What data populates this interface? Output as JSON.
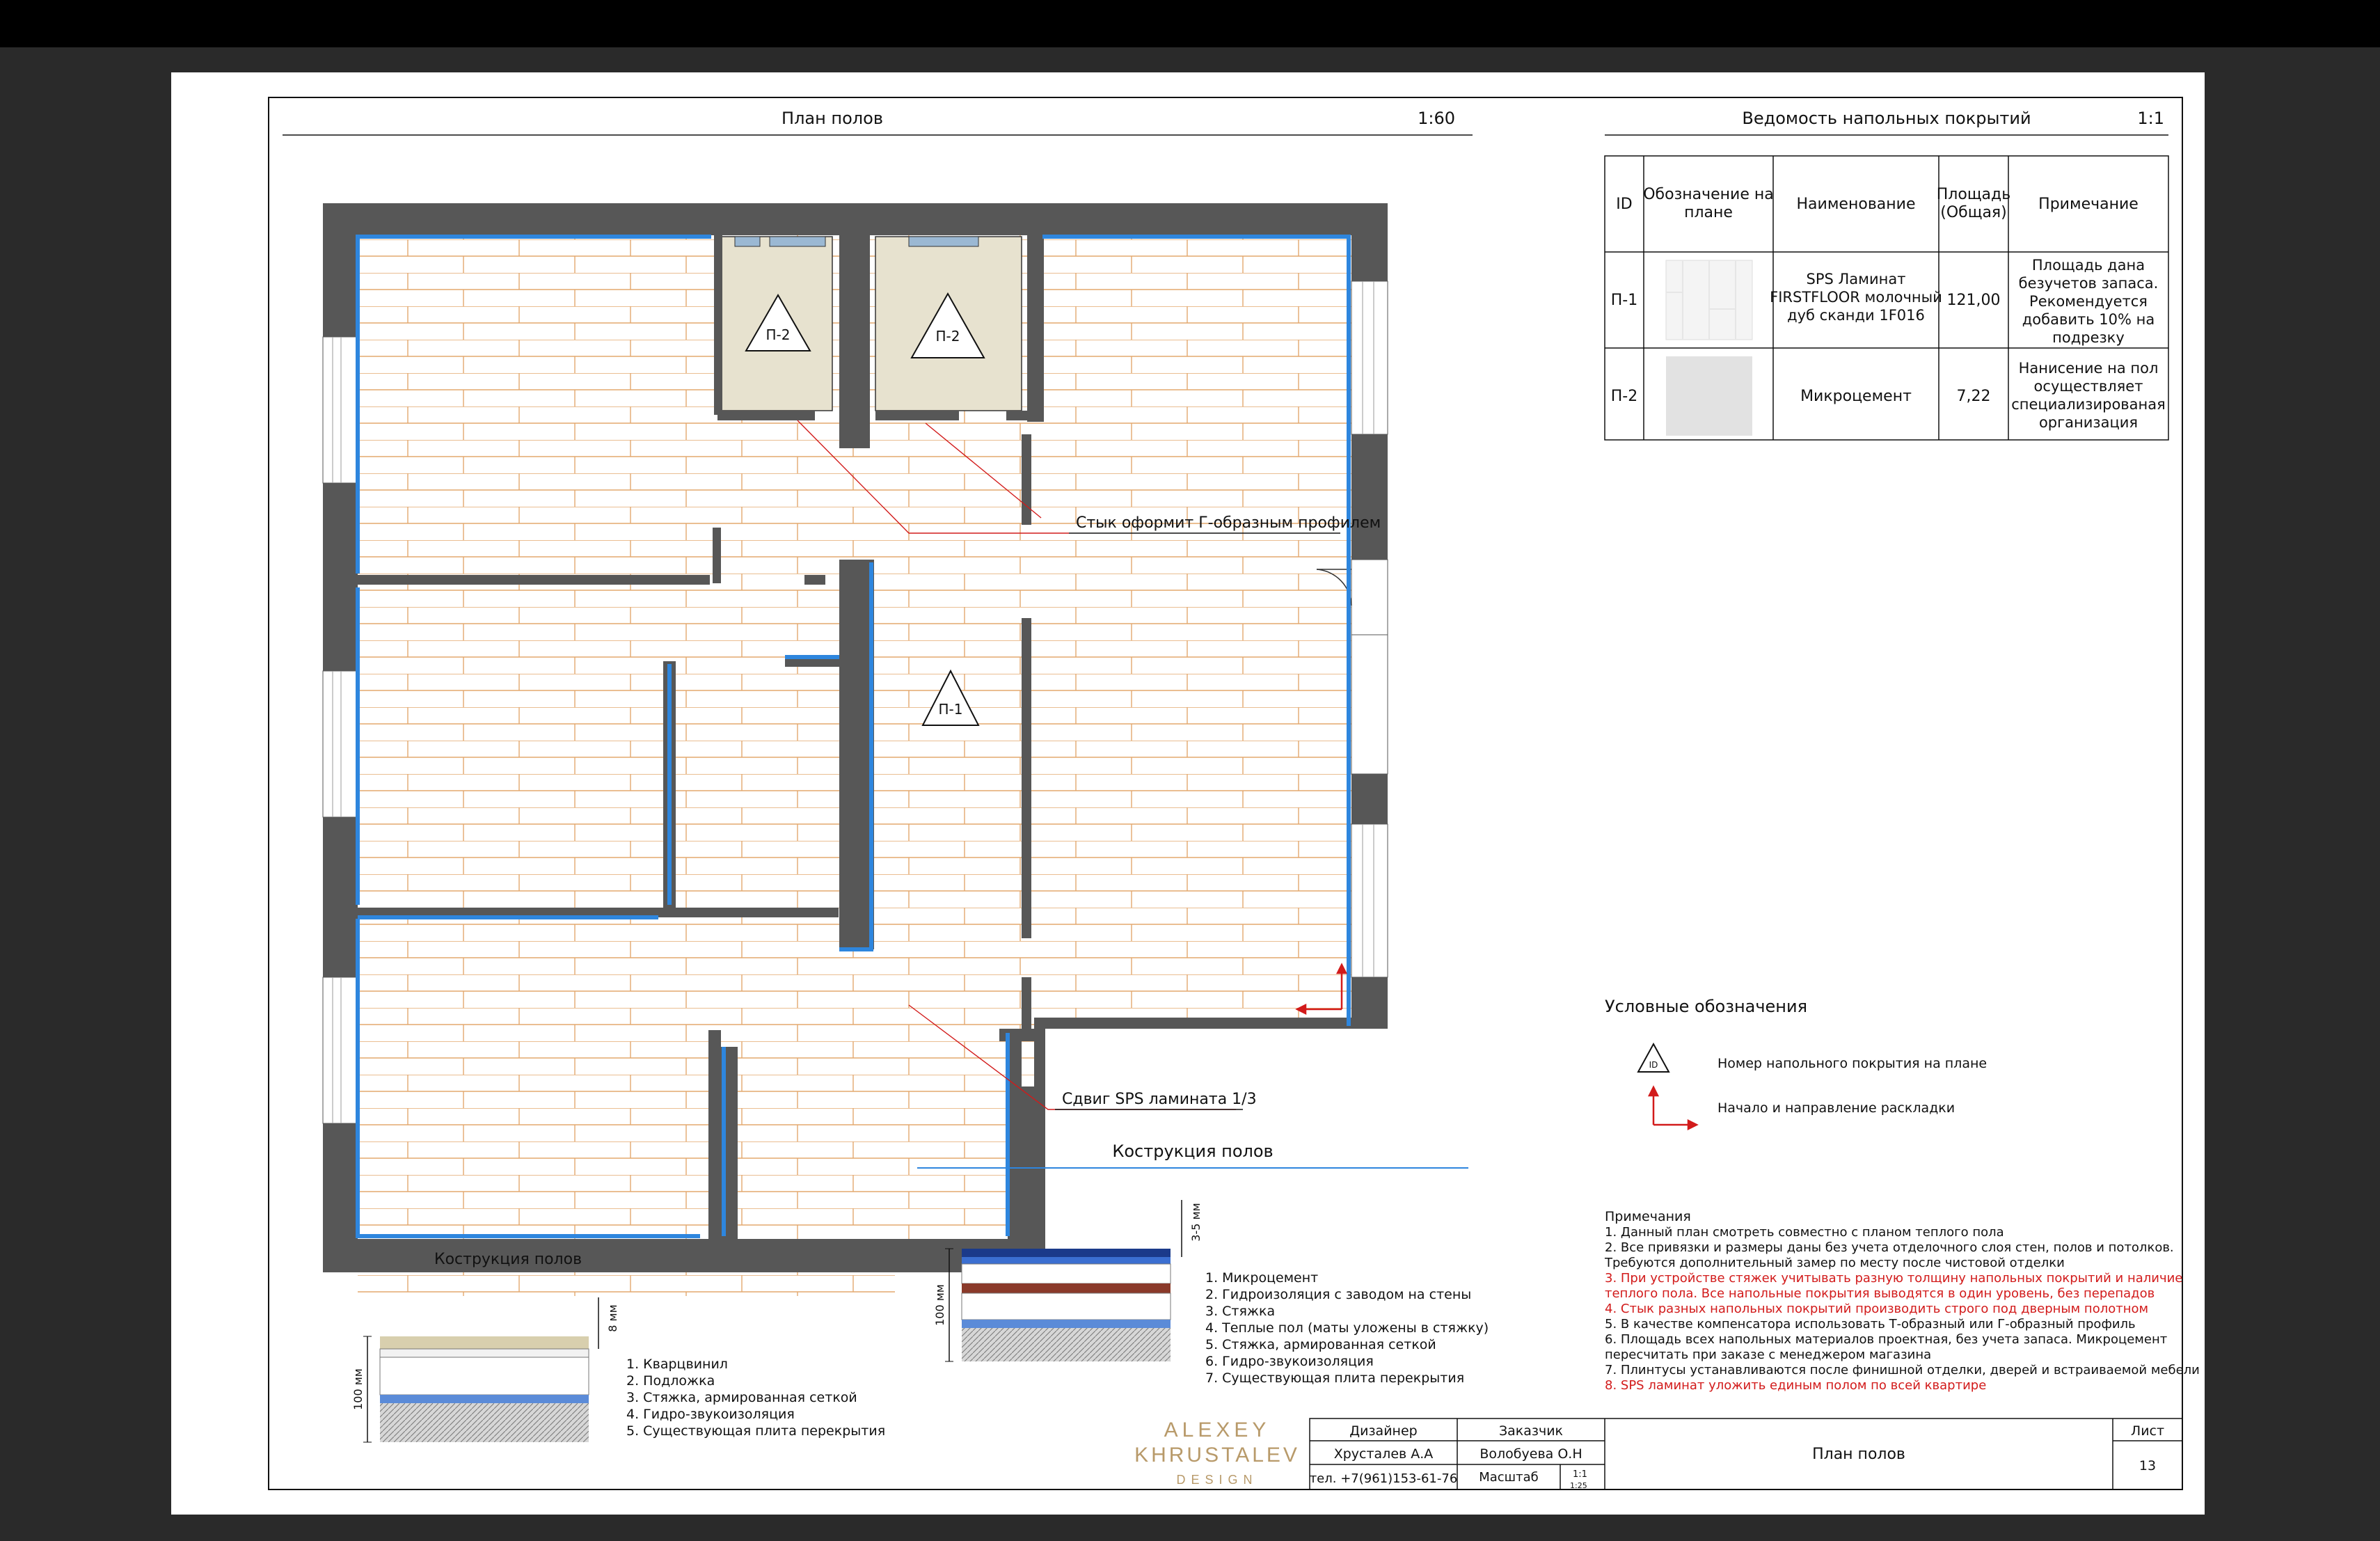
{
  "plan": {
    "title": "План полов",
    "scale": "1:60",
    "label_joint": "Стык оформит Г-образным профилем",
    "label_shift": "Сдвиг SPS ламината 1/3",
    "label_construction_bottom": "Кострукция полов",
    "tag_p1": "П-1",
    "tag_p2a": "П-2",
    "tag_p2b": "П-2"
  },
  "schedule": {
    "title": "Ведомость напольных покрытий",
    "scale": "1:1",
    "headers": [
      "ID",
      "Обозначение на плане",
      "Наименование",
      "Площадь (Общая)",
      "Примечание"
    ],
    "rows": [
      {
        "id": "П-1",
        "name": "SPS Ламинат FIRSTFLOOR молочный дуб сканди 1F016",
        "area": "121,00",
        "note": "Площадь дана безучетов запаса. Рекомендуется добавить 10% на подрезку"
      },
      {
        "id": "П-2",
        "name": "Микроцемент",
        "area": "7,22",
        "note": "Нанисение на пол осуществляет специализированая организация"
      }
    ]
  },
  "legend": {
    "title": "Условные обозначения",
    "symbol_tag": "ID",
    "item1": "Номер напольного покрытия на плане",
    "item2": "Начало и направление раскладки"
  },
  "construction": {
    "title": "Кострукция полов",
    "microcement_layers": [
      "1. Микроцемент",
      "2. Гидроизоляция с заводом на стены",
      "3. Стяжка",
      "4. Теплые пол (маты уложены в стяжку)",
      "5. Стяжка, армированная сеткой",
      "6. Гидро-звукоизоляция",
      "7. Существующая плита перекрытия"
    ],
    "microcement_dim_top": "3-5 мм",
    "microcement_dim_total": "100 мм",
    "laminate_layers": [
      "1. Кварцвинил",
      "2. Подложка",
      "3. Стяжка, армированная сеткой",
      "4. Гидро-звукоизоляция",
      "5. Существующая плита перекрытия"
    ],
    "laminate_dim_top": "8 мм",
    "laminate_dim_total": "100 мм"
  },
  "notes": {
    "title": "Примечания",
    "lines": [
      {
        "text": "1. Данный план смотреть совместно с планом теплого пола",
        "color": "#111111"
      },
      {
        "text": "2. Все привязки и размеры даны без учета отделочного слоя стен, полов и потолков.",
        "color": "#111111"
      },
      {
        "text": "Требуются дополнительный замер по месту после чистовой отделки",
        "color": "#111111"
      },
      {
        "text": "3. При устройстве стяжек учитывать разную толщину напольных покрытий и наличие",
        "color": "#d21b1b"
      },
      {
        "text": "теплого пола. Все напольные покрытия выводятся в один уровень, без перепадов",
        "color": "#d21b1b"
      },
      {
        "text": "4. Стык разных напольных покрытий производить строго под дверным полотном",
        "color": "#d21b1b"
      },
      {
        "text": "5. В качестве компенсатора использовать Т-образный или  Г-образный профиль",
        "color": "#111111"
      },
      {
        "text": "6. Площадь всех напольных материалов проектная, без учета запаса. Микроцемент",
        "color": "#111111"
      },
      {
        "text": "пересчитать при заказе с менеджером магазина",
        "color": "#111111"
      },
      {
        "text": "7. Плинтусы устанавливаются после финишной отделки, дверей и встраиваемой мебели",
        "color": "#111111"
      },
      {
        "text": "8. SPS ламинат уложить единым полом по всей квартире",
        "color": "#d21b1b"
      }
    ]
  },
  "brand": {
    "line1": "ALEXEY",
    "line2": "KHRUSTALEV",
    "line3": "DESIGN",
    "color": "#b89a6a"
  },
  "stamp": {
    "designer_label": "Дизайнер",
    "designer_name": "Хрусталев А.А",
    "phone": "тел. +7(961)153-61-76",
    "client_label": "Заказчик",
    "client_name": "Волобуева О.Н",
    "scale_label": "Масштаб",
    "scale_value": "1:1",
    "scale_value2": "1:25",
    "title": "План полов",
    "sheet_label": "Лист",
    "sheet_number": "13"
  },
  "colors": {
    "wall": "#575757",
    "tile_line": "#e3a86e",
    "insulation": "#2e86de",
    "microcement": "#e7e2cf",
    "red": "#d21b1b"
  }
}
